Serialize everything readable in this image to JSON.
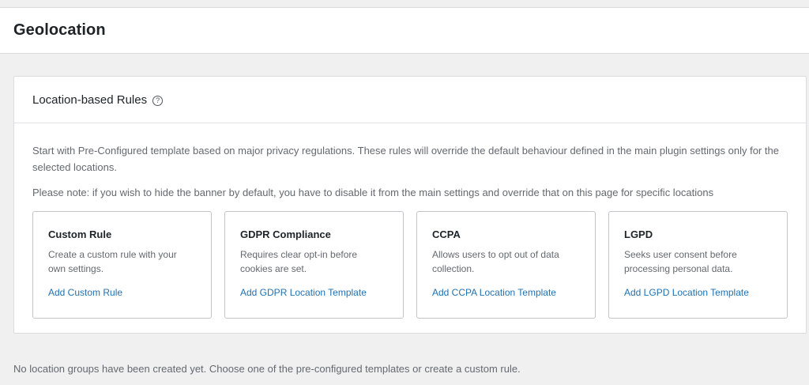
{
  "page": {
    "title": "Geolocation"
  },
  "panel": {
    "title": "Location-based Rules",
    "help_icon": "question-circle-icon",
    "description": "Start with Pre-Configured template based on major privacy regulations. These rules will override the default behaviour defined in the main plugin settings only for the selected locations.",
    "note": "Please note: if you wish to hide the banner by default, you have to disable it from the main settings and override that on this page for specific locations"
  },
  "cards": [
    {
      "title": "Custom Rule",
      "text": "Create a custom rule with your own settings.",
      "link": "Add Custom Rule"
    },
    {
      "title": "GDPR Compliance",
      "text": "Requires clear opt-in before cookies are set.",
      "link": "Add GDPR Location Template"
    },
    {
      "title": "CCPA",
      "text": "Allows users to opt out of data collection.",
      "link": "Add CCPA Location Template"
    },
    {
      "title": "LGPD",
      "text": "Seeks user consent before processing personal data.",
      "link": "Add LGPD Location Template"
    }
  ],
  "footer": {
    "empty_message": "No location groups have been created yet. Choose one of the pre-configured templates or create a custom rule."
  },
  "colors": {
    "link": "#2271b1",
    "heading": "#1d2327",
    "muted": "#646970",
    "background": "#f0f0f1"
  }
}
